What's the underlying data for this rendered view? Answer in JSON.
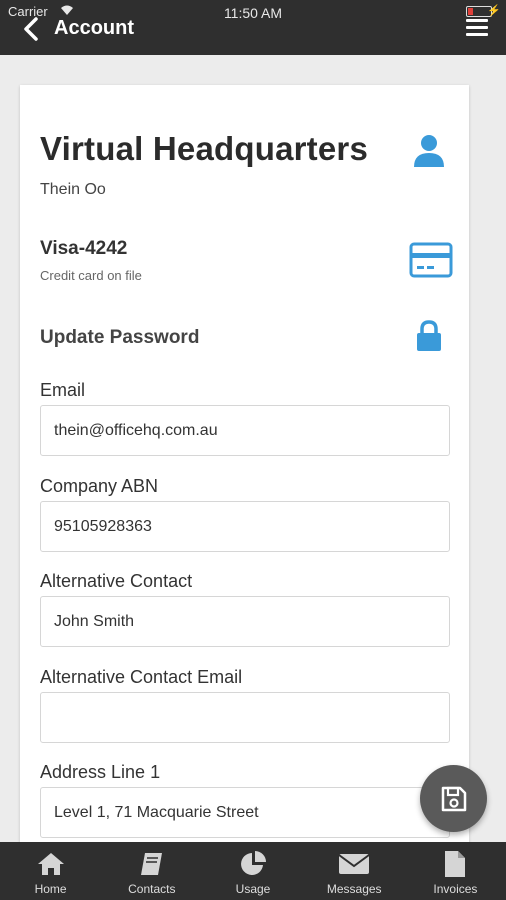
{
  "status_bar": {
    "carrier": "Carrier",
    "time": "11:50 AM"
  },
  "header": {
    "title": "Account",
    "back_icon": "chevron-left-icon",
    "menu_icon": "hamburger-menu-icon"
  },
  "account": {
    "company_name": "Virtual Headquarters",
    "user_name": "Thein Oo",
    "card_label": "Visa-4242",
    "card_sub": "Credit card on file",
    "update_password_label": "Update Password"
  },
  "form": {
    "email": {
      "label": "Email",
      "value": "thein@officehq.com.au"
    },
    "abn": {
      "label": "Company ABN",
      "value": "95105928363"
    },
    "alt_contact": {
      "label": "Alternative Contact",
      "value": "John Smith"
    },
    "alt_email": {
      "label": "Alternative Contact Email",
      "value": ""
    },
    "address1": {
      "label": "Address Line 1",
      "value": "Level 1, 71 Macquarie Street"
    }
  },
  "tabs": [
    {
      "label": "Home",
      "icon": "home-icon"
    },
    {
      "label": "Contacts",
      "icon": "book-icon"
    },
    {
      "label": "Usage",
      "icon": "pie-chart-icon"
    },
    {
      "label": "Messages",
      "icon": "envelope-icon"
    },
    {
      "label": "Invoices",
      "icon": "document-icon"
    }
  ],
  "colors": {
    "accent": "#3a9ad9",
    "header": "#2f2f2f",
    "fab": "#5a5a5a"
  }
}
